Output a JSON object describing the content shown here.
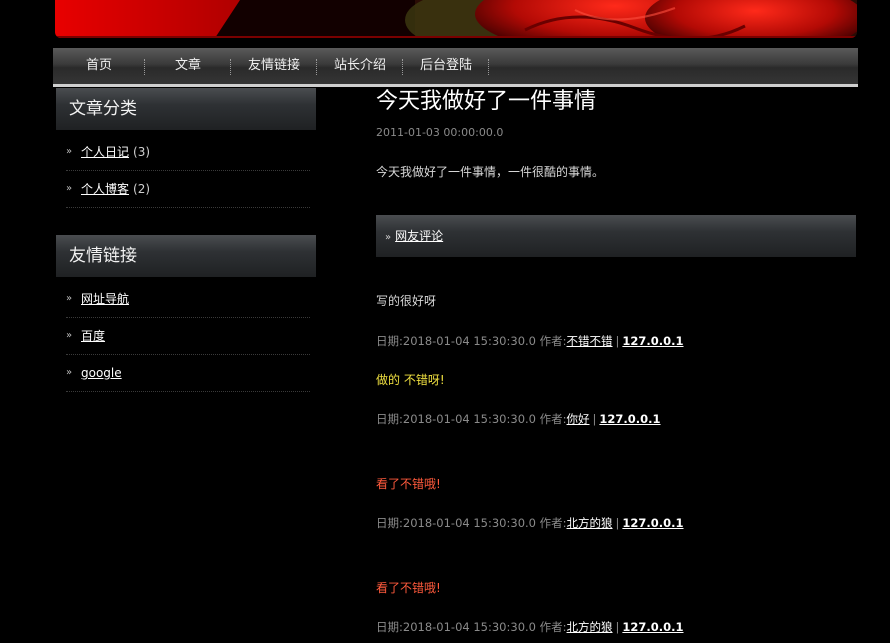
{
  "nav": [
    "首页",
    "文章",
    "友情链接",
    "站长介绍",
    "后台登陆"
  ],
  "sidebar": {
    "categories": {
      "title": "文章分类",
      "items": [
        {
          "label": "个人日记",
          "count": "(3)"
        },
        {
          "label": "个人博客",
          "count": "(2)"
        }
      ]
    },
    "links": {
      "title": "友情链接",
      "items": [
        {
          "label": "网址导航"
        },
        {
          "label": "百度"
        },
        {
          "label": "google"
        }
      ]
    }
  },
  "post": {
    "title": "今天我做好了一件事情",
    "date": "2011-01-03 00:00:00.0",
    "body": "今天我做好了一件事情，一件很酷的事情。"
  },
  "comments_header": "网友评论",
  "comments": [
    {
      "text": "写的很好呀",
      "color": "#d8d8d8",
      "meta_prefix": "日期:2018-01-04 15:30:30.0 作者:",
      "author": "不错不错",
      "ip": "127.0.0.1"
    },
    {
      "text": "做的 不错呀!",
      "color": "#f0e040",
      "meta_prefix": "日期:2018-01-04 15:30:30.0 作者:",
      "author": "你好",
      "ip": "127.0.0.1"
    },
    {
      "text": "看了不错哦!",
      "color": "#ff5a3c",
      "meta_prefix": "日期:2018-01-04 15:30:30.0 作者:",
      "author": "北方的狼",
      "ip": "127.0.0.1"
    },
    {
      "text": "看了不错哦!",
      "color": "#ff5a3c",
      "meta_prefix": "日期:2018-01-04 15:30:30.0 作者:",
      "author": "北方的狼",
      "ip": "127.0.0.1"
    }
  ],
  "colors": {
    "nav_underline": "#cfcfcf",
    "accent_red": "#d00000"
  }
}
